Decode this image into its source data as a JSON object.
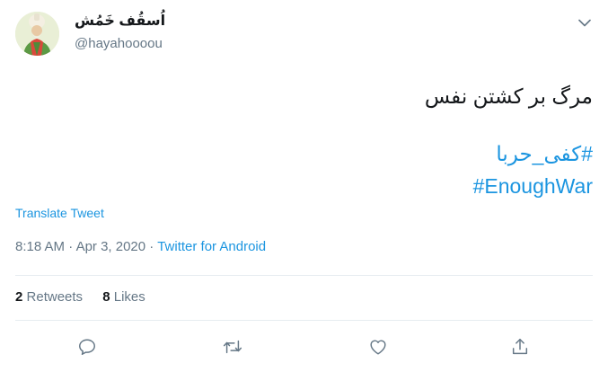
{
  "author": {
    "display_name": "اُسقُف خَمُش",
    "handle": "@hayahoooou"
  },
  "tweet": {
    "text_line": "مرگ بر کشتن نفس",
    "hashtags": [
      "#کفی_حربا",
      "#EnoughWar"
    ]
  },
  "translate_label": "Translate Tweet",
  "meta": {
    "time": "8:18 AM",
    "separator": "·",
    "date": "Apr 3, 2020",
    "source": "Twitter for Android"
  },
  "stats": {
    "retweets_count": "2",
    "retweets_label": "Retweets",
    "likes_count": "8",
    "likes_label": "Likes"
  },
  "icons": {
    "caret": "chevron-down-icon",
    "reply": "reply-icon",
    "retweet": "retweet-icon",
    "like": "heart-icon",
    "share": "share-icon"
  },
  "colors": {
    "link": "#1b95e0",
    "secondary_text": "#657786",
    "primary_text": "#14171a",
    "divider": "#e6ecf0"
  }
}
